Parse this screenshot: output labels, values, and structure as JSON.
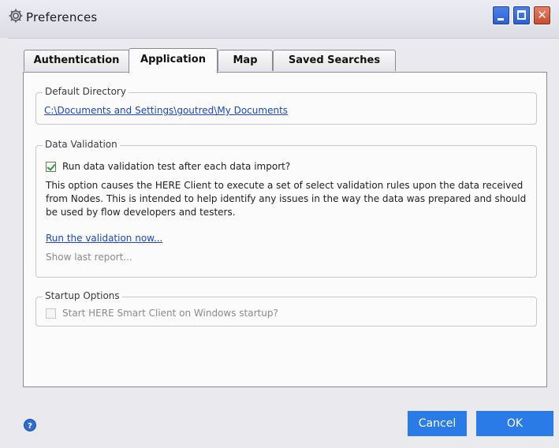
{
  "window": {
    "title": "Preferences",
    "icon": "gear-icon",
    "controls": {
      "minimize": "_",
      "maximize": "□",
      "close": "✕"
    }
  },
  "tabs": [
    {
      "label": "Authentication",
      "active": false
    },
    {
      "label": "Application",
      "active": true
    },
    {
      "label": "Map",
      "active": false
    },
    {
      "label": "Saved Searches",
      "active": false
    }
  ],
  "default_directory": {
    "legend": "Default Directory",
    "path": "C:\\Documents and Settings\\goutred\\My Documents"
  },
  "data_validation": {
    "legend": "Data Validation",
    "checkbox_label": "Run data validation test after each data import?",
    "checked": true,
    "description": "This option causes the HERE Client to execute a set of select validation rules upon the data received from Nodes. This is intended to help identify any issues in the way the data was prepared and should be used by flow developers and testers.",
    "run_link": "Run the validation now...",
    "show_last_report": "Show last report..."
  },
  "startup_options": {
    "legend": "Startup Options",
    "checkbox_label": "Start HERE Smart Client on Windows startup?",
    "checked": false,
    "enabled": false
  },
  "footer": {
    "cancel_label": "Cancel",
    "ok_label": "OK",
    "help_icon": "help-icon"
  },
  "colors": {
    "button_blue": "#2a7be8",
    "link_blue": "#1b46c9",
    "check_green": "#2f9a2f"
  }
}
